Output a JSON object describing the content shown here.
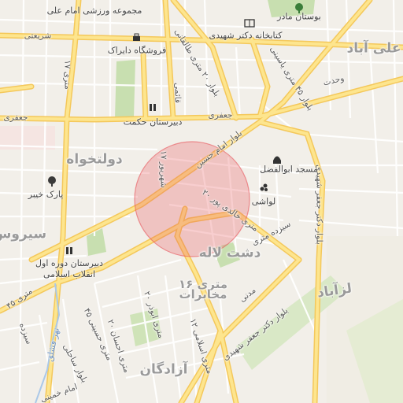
{
  "map": {
    "highlight_color": "#e8535a",
    "road_color": "#fbd46a",
    "park_color": "#c8dfb0",
    "areas": [
      {
        "id": "ali-abad",
        "text": "علی آباد"
      },
      {
        "id": "dowlatkhah",
        "text": "دولتخواه"
      },
      {
        "id": "sirous",
        "text": "سیروس"
      },
      {
        "id": "dasht-lale",
        "text": "دشت لاله"
      },
      {
        "id": "laleh-abad",
        "text": "لزآباد"
      },
      {
        "id": "azadegan",
        "text": "آزادگان"
      },
      {
        "id": "metri16",
        "text": "۱۶ متری مخابرات"
      }
    ],
    "roads": [
      {
        "id": "shariati",
        "text": "شریعتی"
      },
      {
        "id": "jafari-w",
        "text": "جعفری"
      },
      {
        "id": "jafari-e",
        "text": "جعفری"
      },
      {
        "id": "vahdat",
        "text": "وحدت"
      },
      {
        "id": "ghaemi",
        "text": "قائمی"
      },
      {
        "id": "metri-17",
        "text": "۱۷ شهریور"
      },
      {
        "id": "metri-17b",
        "text": "۱۷ متری"
      },
      {
        "id": "imam-hossein",
        "text": "بلوار امام حسین"
      },
      {
        "id": "khalidi",
        "text": "۲۰ متری خالدی پور"
      },
      {
        "id": "sizdeh",
        "text": "سیزده متری"
      },
      {
        "id": "taleghani",
        "text": "بلوار ۲۰ متری طالقانی"
      },
      {
        "id": "yasini",
        "text": "بلوار ۴۵ متری یاسینی"
      },
      {
        "id": "jafar-shahidi",
        "text": "بلوار دکتر جعفر شهیدی"
      },
      {
        "id": "jafar-shahidi2",
        "text": "بلوار دکتر جعفر شهیدی"
      },
      {
        "id": "madani",
        "text": "مدنی"
      },
      {
        "id": "ehsan",
        "text": "۲۰ متری احسان"
      },
      {
        "id": "abuzar",
        "text": "۲۰ متری ابوذر"
      },
      {
        "id": "eslami",
        "text": "۱۲ متری اسلامی"
      },
      {
        "id": "sahel",
        "text": "بلوار ساحلی"
      },
      {
        "id": "hosseini",
        "text": "۴۵ متری حسینی"
      },
      {
        "id": "imam-khomeini",
        "text": "امام خمینی"
      },
      {
        "id": "metri-40",
        "text": "۴۵ متری"
      },
      {
        "id": "harv",
        "text": "نهر فشلق"
      },
      {
        "id": "khayyam",
        "text": "سیزده"
      }
    ],
    "pois": [
      {
        "id": "boostan-madar",
        "text": "بوستان مادر",
        "icon": "tree-icon"
      },
      {
        "id": "ketabkhane",
        "text": "کتابخانه دکتر شهیدی",
        "icon": "book-icon"
      },
      {
        "id": "majmooe",
        "text": "مجموعه ورزشی امام علی",
        "icon": "none"
      },
      {
        "id": "forooshgah",
        "text": "فروشگاه دایراک",
        "icon": "shop-icon"
      },
      {
        "id": "hekmat",
        "text": "دبیرستان حکمت",
        "icon": "school-icon"
      },
      {
        "id": "abolfazl",
        "text": "مسجد ابوالفضل",
        "icon": "mosque-icon"
      },
      {
        "id": "lavashi",
        "text": "لواشی",
        "icon": "food-icon"
      },
      {
        "id": "park-khayyer",
        "text": "پارک خیبر",
        "icon": "tree-icon"
      },
      {
        "id": "dabirestan-avval",
        "text": "دبیرستان دوره اول\nانقلاب اسلامی",
        "icon": "school-icon"
      }
    ]
  }
}
